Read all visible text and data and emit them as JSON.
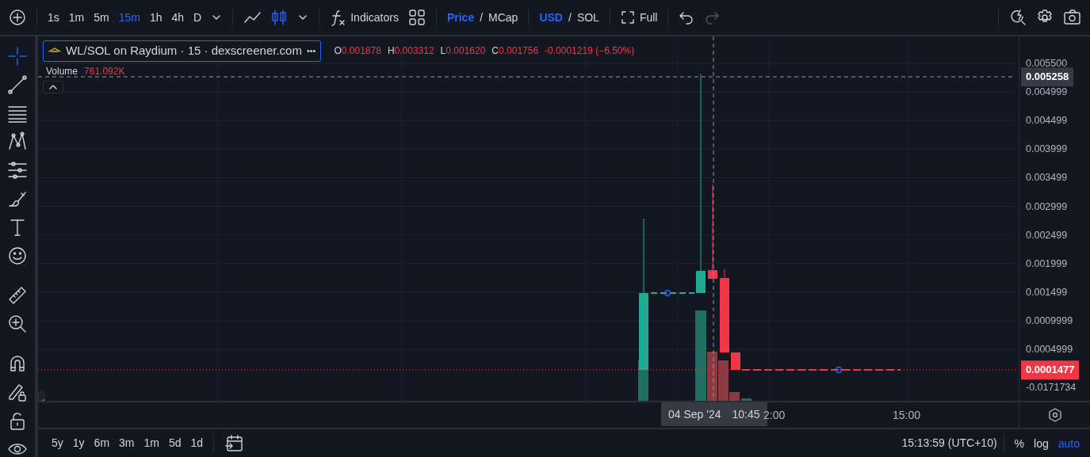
{
  "toolbar": {
    "intervals": [
      {
        "label": "1s",
        "selected": false
      },
      {
        "label": "1m",
        "selected": false
      },
      {
        "label": "5m",
        "selected": false
      },
      {
        "label": "15m",
        "selected": true
      },
      {
        "label": "1h",
        "selected": false
      },
      {
        "label": "4h",
        "selected": false
      },
      {
        "label": "D",
        "selected": false
      }
    ],
    "chart_types": [
      {
        "kind": "line",
        "selected": false
      },
      {
        "kind": "candles",
        "selected": true
      }
    ],
    "indicators": "Indicators",
    "price_toggle": [
      {
        "label": "Price",
        "selected": true
      },
      {
        "label": "MCap",
        "selected": false
      }
    ],
    "currency_toggle": [
      {
        "label": "USD",
        "selected": true
      },
      {
        "label": "SOL",
        "selected": false
      }
    ],
    "separator": "/",
    "fullscreen": "Full",
    "redo": {
      "disabled": true
    }
  },
  "legend": {
    "symbol": "WL/SOL on Raydium · 15 · dexscreener.com",
    "more": "•••",
    "ohlc": [
      {
        "key": "O",
        "value": "0.001878"
      },
      {
        "key": "H",
        "value": "0.003312"
      },
      {
        "key": "L",
        "value": "0.001620"
      },
      {
        "key": "C",
        "value": "0.001756"
      }
    ],
    "change": "-0.0001219 (−6.50%)",
    "volume_label": "Volume",
    "volume_value": "761.092K"
  },
  "left_tools": [
    {
      "kind": "crosshair",
      "selected": true
    },
    {
      "kind": "trend-line",
      "selected": false
    },
    {
      "kind": "fib",
      "selected": false
    },
    {
      "kind": "pattern",
      "selected": false
    },
    {
      "kind": "projection",
      "selected": false
    },
    {
      "kind": "brush",
      "selected": false
    },
    {
      "kind": "text",
      "selected": false
    },
    {
      "kind": "emoji",
      "selected": false
    },
    {
      "kind": "ruler",
      "selected": false
    },
    {
      "kind": "zoom",
      "selected": false
    },
    {
      "kind": "magnet",
      "selected": false
    },
    {
      "kind": "lock-drawing",
      "selected": false
    },
    {
      "kind": "lock",
      "selected": false
    },
    {
      "kind": "eye",
      "selected": false
    }
  ],
  "price_axis": {
    "labels": [
      "0.005500",
      "0.004999",
      "0.004499",
      "0.003999",
      "0.003499",
      "0.002999",
      "0.002499",
      "0.001999",
      "0.001499",
      "0.0009999",
      "0.0004999",
      "-0.0171734"
    ],
    "crosshair_price": "0.005258",
    "last_price": "0.0001477"
  },
  "time_axis": {
    "labels": [
      "2:00",
      "15:00"
    ],
    "crosshair_date": "04 Sep '24",
    "crosshair_time": "10:45"
  },
  "ranges": [
    "5y",
    "1y",
    "6m",
    "3m",
    "1m",
    "5d",
    "1d"
  ],
  "clock": "15:13:59 (UTC+10)",
  "scale_modes": [
    {
      "label": "%",
      "selected": false
    },
    {
      "label": "log",
      "selected": false
    },
    {
      "label": "auto",
      "selected": true
    }
  ]
}
